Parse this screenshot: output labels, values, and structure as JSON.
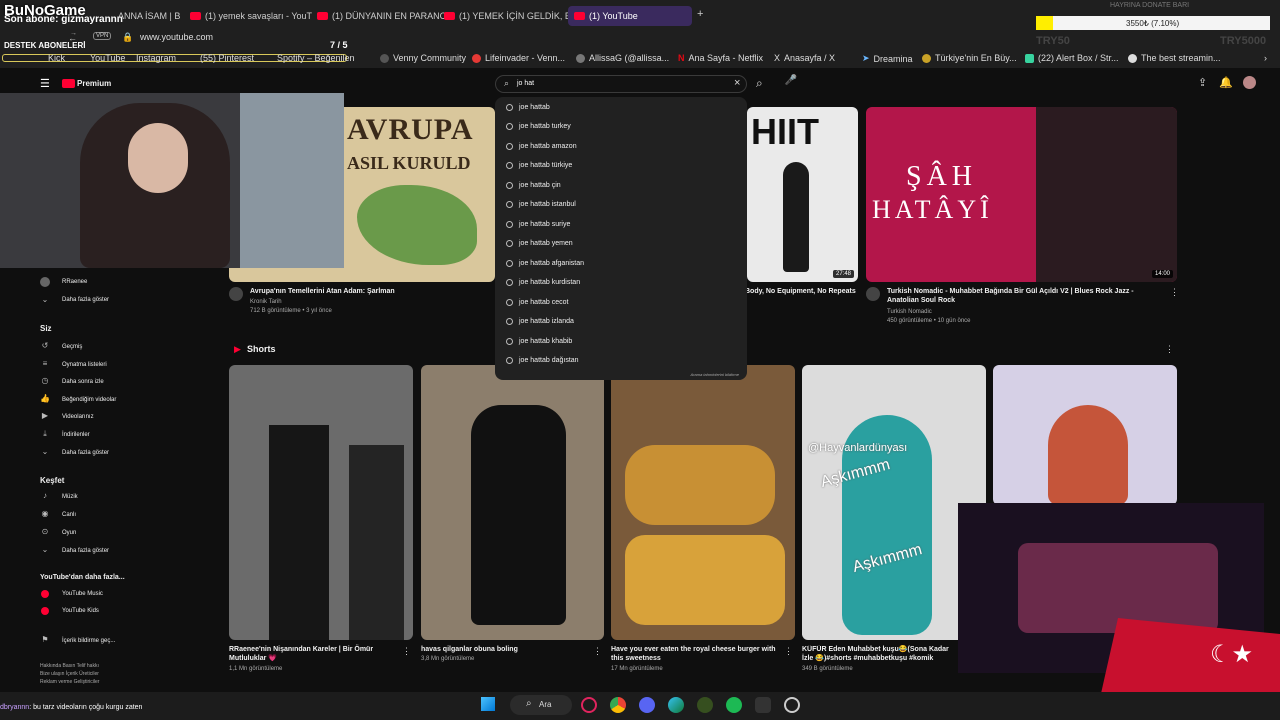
{
  "overlay": {
    "channel_logo": "BuNoGame",
    "last_sub": "Son abone: gizmayrannn",
    "support_label": "DESTEK ABONELERİ",
    "support_count": "7 / 5",
    "donate_label": "HAYRINA DONATE BARI",
    "donate_progress_text": "3550₺ (7.10%)",
    "donate_fraction": 0.071,
    "left_currency": "TRY50",
    "right_currency": "TRY5000",
    "chat_user": "dbryannn",
    "chat_message": ": bu tarz videoların çoğu kurgu zaten"
  },
  "browser": {
    "tabs": [
      {
        "label": "ANNA İSAM | B"
      },
      {
        "label": "(1) yemek savaşları - YouT"
      },
      {
        "label": "(1) DÜNYANIN EN PARANC"
      },
      {
        "label": "(1) YEMEK İÇİN GELDİK, E"
      },
      {
        "label": "(1) YouTube"
      }
    ],
    "url": "www.youtube.com",
    "bookmarks": [
      "Kick",
      "YouTube",
      "Instagram",
      "(55) Pinterest",
      "Spotify – Beğenilen",
      "Venny Community",
      "Lifeinvader - Venn...",
      "AllissaG (@allissa...",
      "Ana Sayfa - Netflix",
      "Anasayfa / X",
      "Dreamina",
      "Türkiye'nin En Büy...",
      "(22) Alert Box / Str...",
      "The best streamin..."
    ]
  },
  "youtube": {
    "logo": "Premium",
    "search_value": "jo hat",
    "suggestions": [
      "joe hattab",
      "joe hattab turkey",
      "joe hattab amazon",
      "joe hattab türkiye",
      "joe hattab çin",
      "joe hattab istanbul",
      "joe hattab suriye",
      "joe hattab yemen",
      "joe hattab afganistan",
      "joe hattab kurdistan",
      "joe hattab cecot",
      "joe hattab izlanda",
      "joe hattab khabib",
      "joe hattab dağıstan"
    ],
    "report_text": "Arama tahminlerini bildirme",
    "sidebar": {
      "sub_item": "RRaenee",
      "show_more_1": "Daha fazla göster",
      "you_header": "Siz",
      "you_items": [
        "Geçmiş",
        "Oynatma listeleri",
        "Daha sonra izle",
        "Beğendiğim videolar",
        "Videolarınız",
        "İndirilenler",
        "Daha fazla göster"
      ],
      "explore_header": "Keşfet",
      "explore_items": [
        "Müzik",
        "Canlı",
        "Oyun",
        "Daha fazla göster"
      ],
      "more_header": "YouTube'dan daha fazla...",
      "more_items": [
        "YouTube Music",
        "YouTube Kids"
      ],
      "report": "İçerik bildirme geç...",
      "footer1": "Hakkında  Basın  Telif hakkı",
      "footer2": "Bize ulaşın  İçerik Üreticiler",
      "footer3": "Reklam verme  Geliştiriciler"
    },
    "videos": [
      {
        "title": "Avrupa'nın Temellerini Atan Adam: Şarlman",
        "channel": "Kronik Tarih",
        "meta": "712 B görüntüleme • 3 yıl önce",
        "thumb_text1": "AVRUPA",
        "thumb_text2": "ASIL KURULD"
      },
      {
        "title": "Body, No Equipment, No Repeats",
        "thumb_text": "HIIT",
        "duration": "27:48"
      },
      {
        "title": "Turkish Nomadic - Muhabbet Bağında Bir Gül Açıldı V2 | Blues Rock Jazz - Anatolian Soul Rock",
        "channel": "Turkish Nomadic",
        "meta": "450 görüntüleme • 10 gün önce",
        "thumb_text1": "ŞÂH",
        "thumb_text2": "HATÂYÎ",
        "duration": "14:00"
      }
    ],
    "shorts_header": "Shorts",
    "shorts": [
      {
        "title": "RRaenee'nin Nişanından Kareler | Bir Ömür Mutluluklar 💗",
        "views": "1,1 Mn görüntüleme"
      },
      {
        "title": "havas qilganlar obuna boling",
        "views": "3,8 Mn görüntüleme"
      },
      {
        "title": "Have you ever eaten the royal cheese burger with this sweetness",
        "views": "17 Mn görüntüleme"
      },
      {
        "title": "KÜFÜR Eden Muhabbet kuşu😂(Sona Kadar İzle 😂)#shorts #muhabbetkuşu #komik #hayvanlar",
        "views": "349 B görüntüleme",
        "overlay1": "@Hayvanlardünyası",
        "overlay2": "Aşkımmm"
      },
      {
        "title": "",
        "views": ""
      }
    ]
  },
  "taskbar": {
    "search_label": "Ara"
  }
}
